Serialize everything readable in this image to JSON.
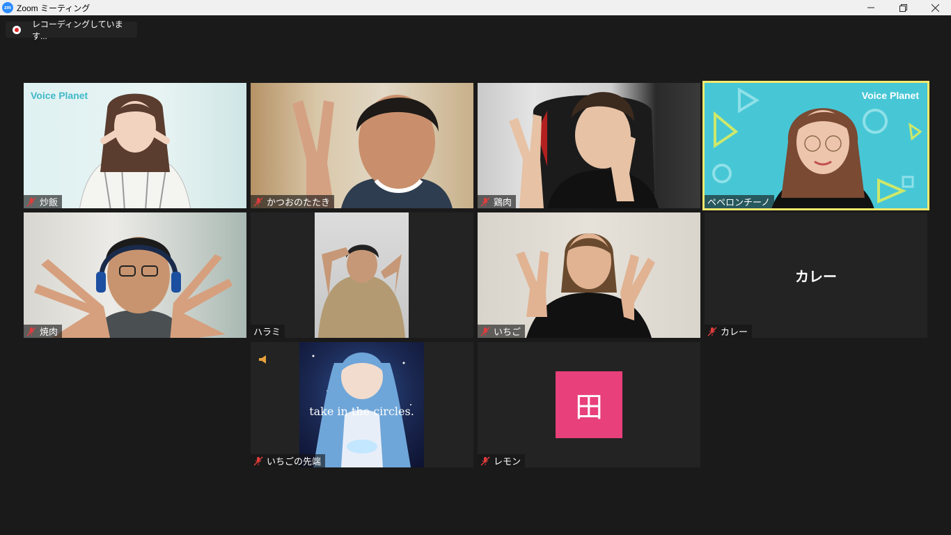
{
  "window": {
    "title": "Zoom ミーティング",
    "app_icon": "zm",
    "controls": [
      "minimize-icon",
      "restore-icon",
      "close-icon"
    ]
  },
  "recording": {
    "status_text": "レコーディングしています..."
  },
  "colors": {
    "background": "#1a1a1a",
    "tile": "#232323",
    "active_speaker_border": "#f4e96c",
    "avatar": "#e8407a",
    "muted_mic": "#e03c3c"
  },
  "participants": [
    {
      "name": "炒飯",
      "muted": true,
      "video": true,
      "overlay_logo": "Voice Planet"
    },
    {
      "name": "かつおのたたき",
      "muted": true,
      "video": true
    },
    {
      "name": "鶏肉",
      "muted": true,
      "video": true
    },
    {
      "name": "ペペロンチーノ",
      "muted": false,
      "video": true,
      "active_speaker": true,
      "overlay_logo": "Voice Planet"
    },
    {
      "name": "焼肉",
      "muted": true,
      "video": true
    },
    {
      "name": "ハラミ",
      "muted": false,
      "video": true
    },
    {
      "name": "いちご",
      "muted": true,
      "video": true
    },
    {
      "name": "カレー",
      "muted": true,
      "video": false,
      "center_label": "カレー"
    },
    {
      "name": "いちごの先端",
      "muted": true,
      "video": true,
      "sharing_audio": true,
      "artwork_caption": "take in the circles."
    },
    {
      "name": "レモン",
      "muted": true,
      "video": false,
      "avatar_initial": "田"
    }
  ]
}
